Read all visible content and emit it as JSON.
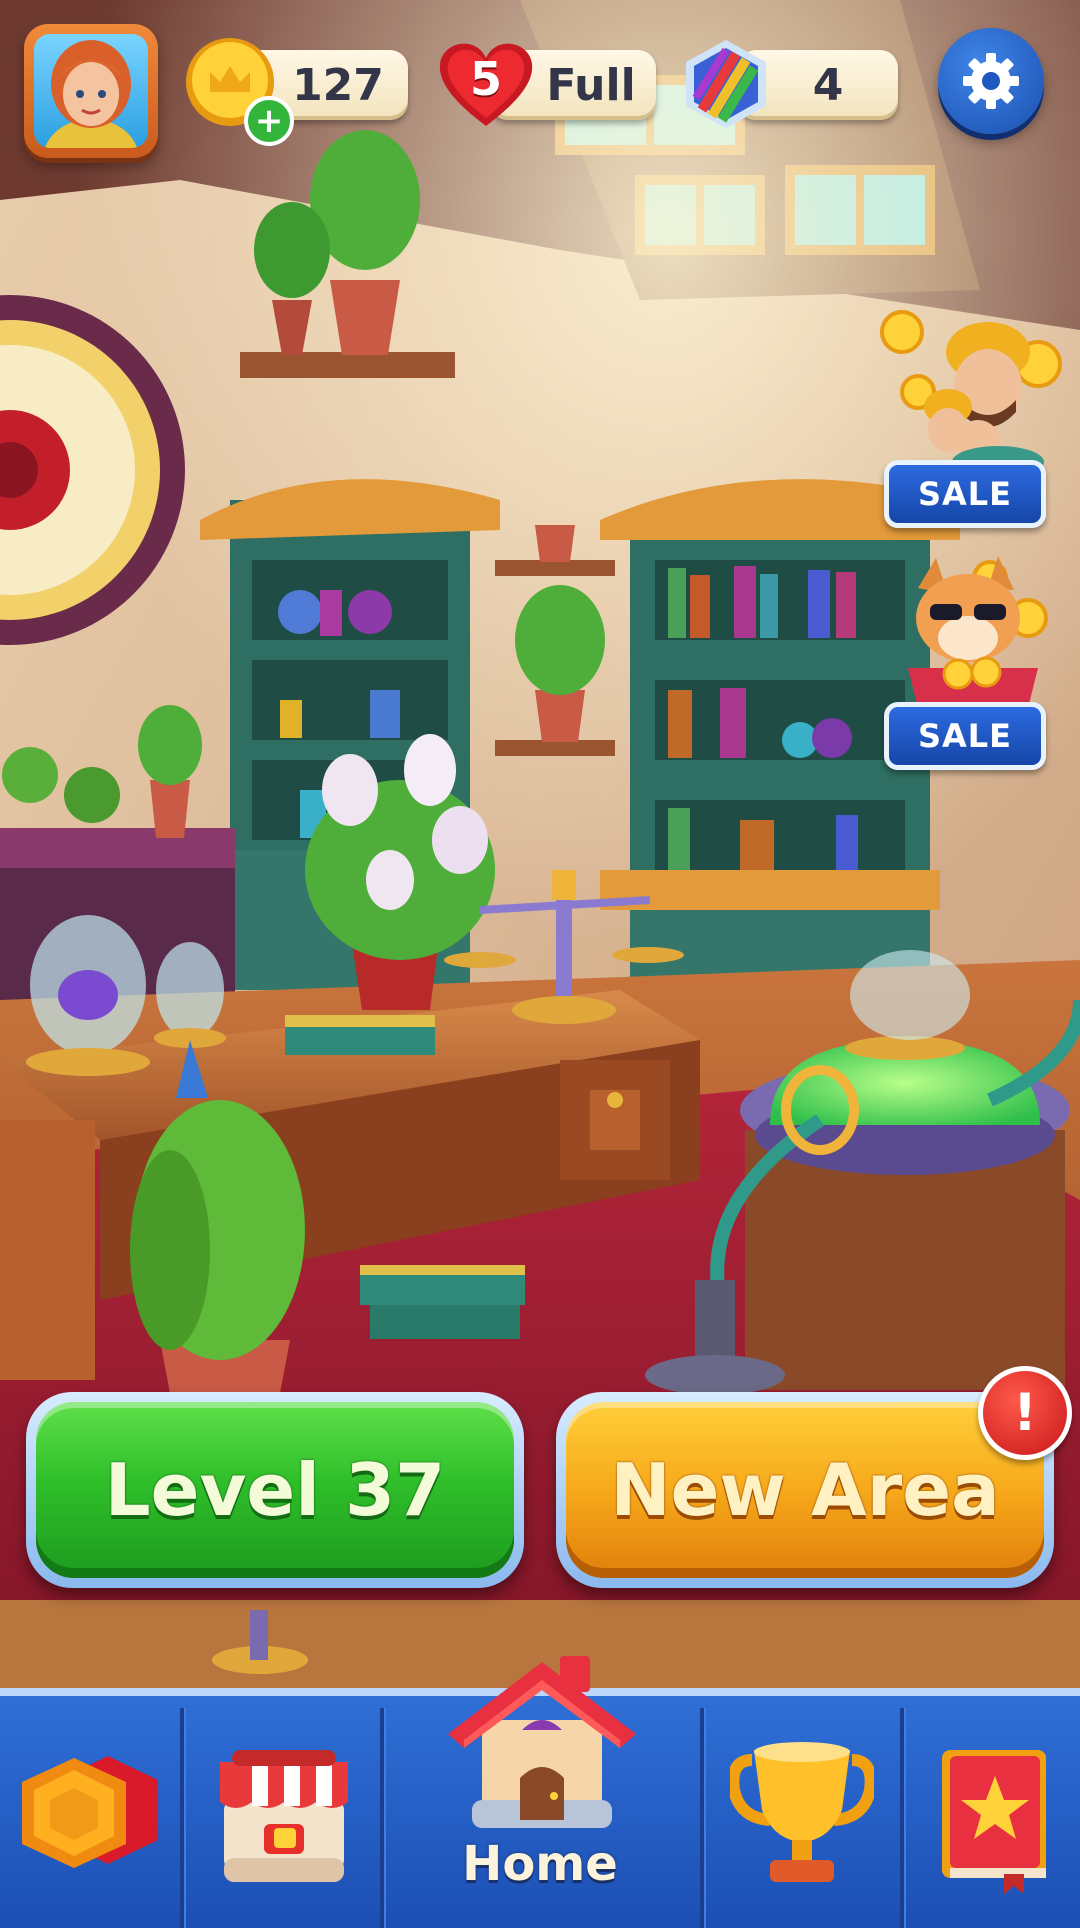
{
  "hud": {
    "coins": "127",
    "lives": "5",
    "lives_status": "Full",
    "boosters": "4"
  },
  "offers": {
    "offer_1_label": "SALE",
    "offer_2_label": "SALE"
  },
  "buttons": {
    "level_label": "Level 37",
    "new_area_label": "New Area",
    "new_area_alert": "!"
  },
  "nav": {
    "home_label": "Home",
    "items": [
      "hexagon-pieces-icon",
      "shop-icon",
      "home-icon",
      "trophy-icon",
      "star-book-icon"
    ]
  },
  "icons": {
    "avatar": "player-avatar",
    "coins": "crown-coin-icon",
    "coins_add": "plus-icon",
    "lives": "heart-icon",
    "boosters": "rainbow-hexagon-icon",
    "settings": "gear-icon"
  },
  "colors": {
    "level_button": "#2fbf2a",
    "new_area_button": "#f7a91a",
    "nav_bar": "#2f6fd6",
    "sale_badge": "#1646a8",
    "alert_badge": "#c8161a"
  }
}
